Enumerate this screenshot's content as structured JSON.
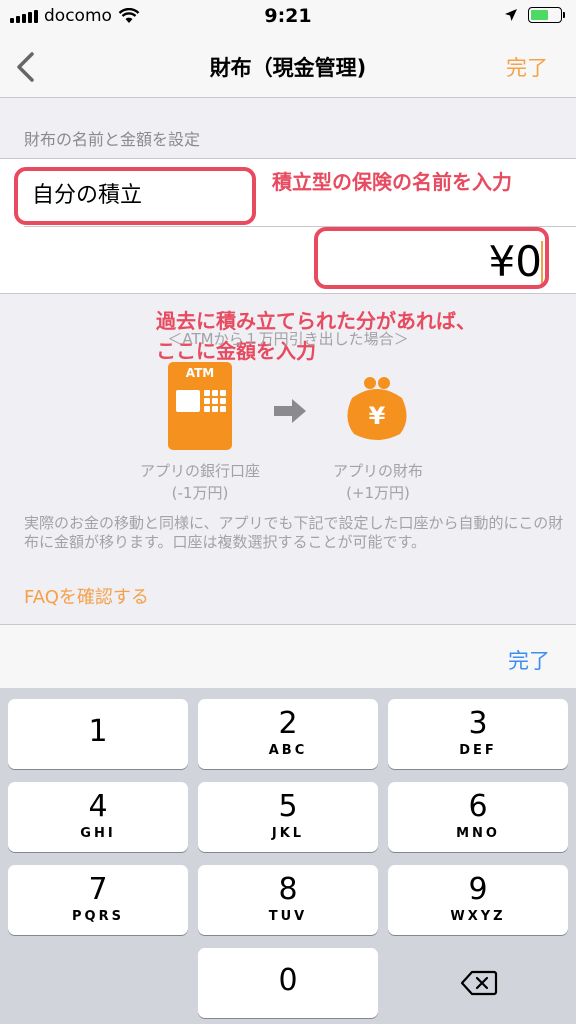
{
  "status_bar": {
    "carrier": "docomo",
    "time": "9:21"
  },
  "nav": {
    "title": "財布（現金管理)",
    "done_label": "完了"
  },
  "section": {
    "header": "財布の名前と金額を設定"
  },
  "form": {
    "name_value": "自分の積立",
    "amount_value": "¥0"
  },
  "annotations": {
    "name_note": "積立型の保険の名前を入力",
    "amount_note_line1": "過去に積み立てられた分があれば、",
    "amount_note_line2": "ここに金額を入力"
  },
  "explanation": {
    "header": "＜ATMから１万円引き出した場合＞",
    "atm_label": "ATM",
    "wallet_symbol": "¥",
    "bank_caption": "アプリの銀行口座",
    "bank_amount": "(-1万円)",
    "wallet_caption": "アプリの財布",
    "wallet_amount": "(+1万円)",
    "description": "実際のお金の移動と同様に、アプリでも下記で設定した口座から自動的にこの財布に金額が移ります。口座は複数選択することが可能です。",
    "faq_link": "FAQを確認する"
  },
  "keyboard": {
    "done_label": "完了",
    "keys": [
      {
        "num": "1",
        "letters": ""
      },
      {
        "num": "2",
        "letters": "ABC"
      },
      {
        "num": "3",
        "letters": "DEF"
      },
      {
        "num": "4",
        "letters": "GHI"
      },
      {
        "num": "5",
        "letters": "JKL"
      },
      {
        "num": "6",
        "letters": "MNO"
      },
      {
        "num": "7",
        "letters": "PQRS"
      },
      {
        "num": "8",
        "letters": "TUV"
      },
      {
        "num": "9",
        "letters": "WXYZ"
      },
      {
        "num": "0",
        "letters": ""
      }
    ]
  },
  "colors": {
    "accent_orange": "#f4a14a",
    "annotation_red": "#e84a5f",
    "keyboard_done_blue": "#3c8ff0"
  }
}
